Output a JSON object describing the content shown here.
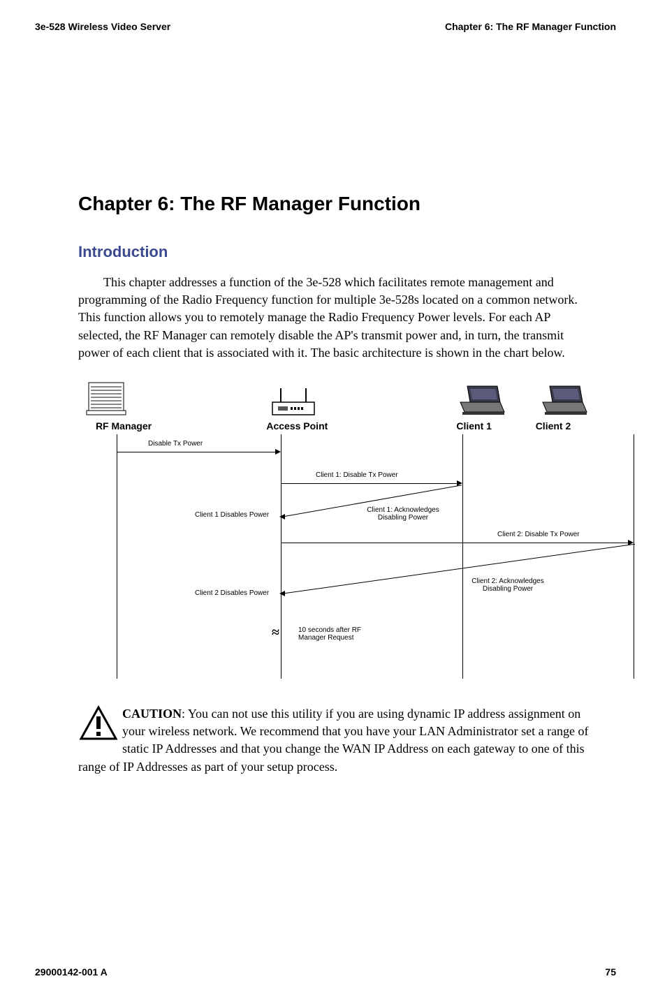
{
  "header": {
    "left": "3e-528 Wireless Video Server",
    "right": "Chapter 6: The RF Manager Function"
  },
  "chapter_title": "Chapter 6: The RF Manager Function",
  "section_title": "Introduction",
  "intro_para": "This chapter addresses a function of the 3e-528 which facilitates remote management and programming of the Radio Frequency function for multiple 3e-528s located on a common network. This function allows you to remotely manage the Radio Frequency Power levels. For each AP selected, the RF Manager can remotely disable the AP's transmit power and, in turn, the transmit power of each client that is associated with it. The basic architecture is shown in the chart below.",
  "diagram": {
    "labels": {
      "rf_manager": "RF Manager",
      "access_point": "Access Point",
      "client1": "Client 1",
      "client2": "Client 2"
    },
    "messages": {
      "disable_tx": "Disable Tx Power",
      "c1_disable": "Client 1: Disable Tx Power",
      "c1_disables_power": "Client 1 Disables Power",
      "c1_ack": "Client 1: Acknowledges Disabling Power",
      "c2_disable": "Client 2: Disable Tx Power",
      "c2_disables_power": "Client 2 Disables Power",
      "c2_ack": "Client 2: Acknowledges Disabling Power",
      "pause": "10 seconds after RF Manager Request"
    }
  },
  "caution": {
    "label": "CAUTION",
    "text": ": You can not use this utility if you are using dynamic IP address assignment on your wireless network. We recommend that you have your LAN Administrator set a range of static IP Addresses and that you change the WAN IP Address on each gateway to one of this range of IP Addresses as part of your setup process."
  },
  "footer": {
    "left": "29000142-001 A",
    "right": "75"
  }
}
